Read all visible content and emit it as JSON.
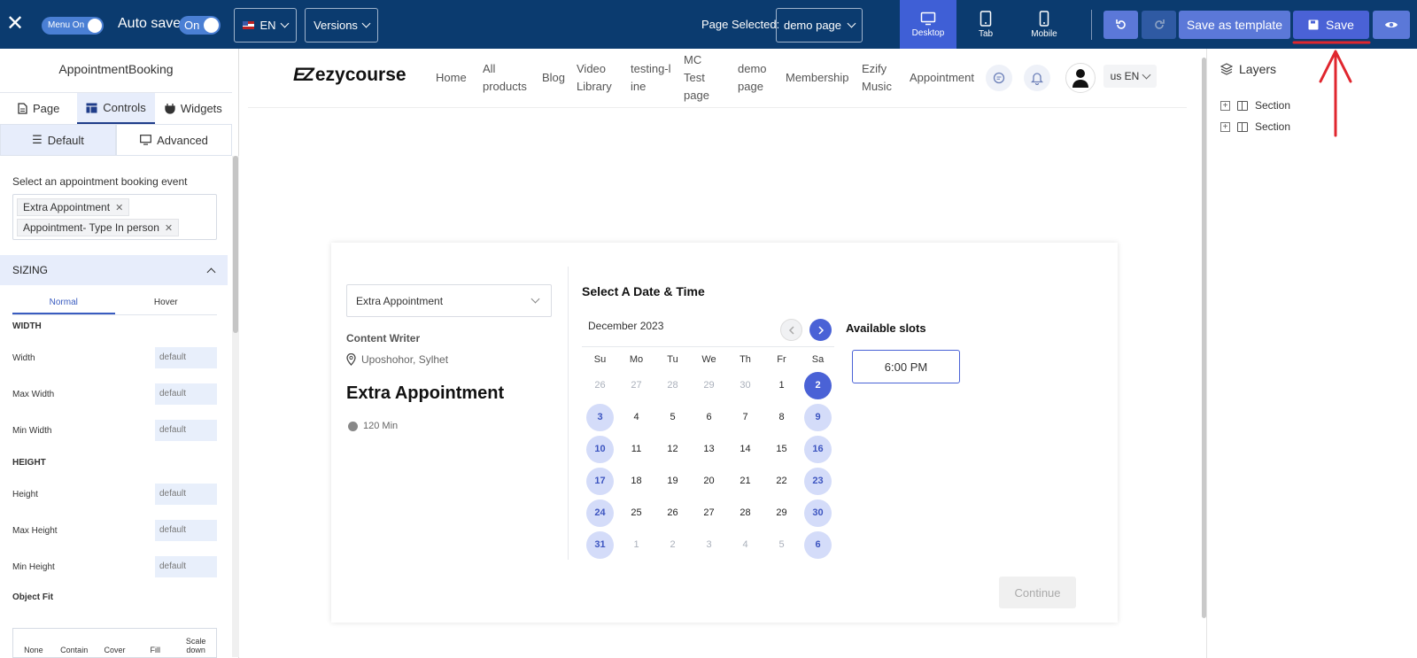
{
  "topbar": {
    "menu_toggle": "Menu On",
    "autosave_label": "Auto save:",
    "autosave_state": "On",
    "language": "EN",
    "versions": "Versions",
    "page_selected_label": "Page Selected:",
    "page_selected_value": "demo page",
    "devices": [
      {
        "label": "Desktop",
        "icon": "desktop-icon",
        "active": true
      },
      {
        "label": "Tab",
        "icon": "tablet-icon",
        "active": false
      },
      {
        "label": "Mobile",
        "icon": "mobile-icon",
        "active": false
      }
    ],
    "save_template": "Save as template",
    "save": "Save"
  },
  "left_panel": {
    "title": "AppointmentBooking",
    "tabs": [
      "Page",
      "Controls",
      "Widgets"
    ],
    "sub_tabs": [
      "Default",
      "Advanced"
    ],
    "event_select_label": "Select an appointment booking event",
    "selected_events": [
      "Extra Appointment",
      "Appointment- Type In person"
    ],
    "sizing_header": "SIZING",
    "state_tabs": [
      "Normal",
      "Hover"
    ],
    "width_section": "WIDTH",
    "height_section": "HEIGHT",
    "width_props": [
      {
        "label": "Width",
        "value": "default"
      },
      {
        "label": "Max Width",
        "value": "default"
      },
      {
        "label": "Min Width",
        "value": "default"
      }
    ],
    "height_props": [
      {
        "label": "Height",
        "value": "default"
      },
      {
        "label": "Max Height",
        "value": "default"
      },
      {
        "label": "Min Height",
        "value": "default"
      }
    ],
    "object_fit_label": "Object Fit",
    "object_fit_options": [
      "None",
      "Contain",
      "Cover",
      "Fill",
      "Scale down"
    ]
  },
  "site": {
    "logo_mark": "EZ",
    "logo_text": "ezycourse",
    "nav": [
      "Home",
      "All products",
      "Blog",
      "Video Library",
      "testing-line",
      "MC Test page",
      "demo page",
      "Membership",
      "Ezify Music",
      "Appointment"
    ],
    "locale": "us EN"
  },
  "booking": {
    "event_select": "Extra Appointment",
    "host": "Content Writer",
    "location": "Uposhohor, Sylhet",
    "title": "Extra Appointment",
    "duration": "120 Min",
    "calendar_heading": "Select A Date & Time",
    "month": "December 2023",
    "weekdays": [
      "Su",
      "Mo",
      "Tu",
      "We",
      "Th",
      "Fr",
      "Sa"
    ],
    "weeks": [
      [
        {
          "d": "26",
          "s": "muted"
        },
        {
          "d": "27",
          "s": "muted"
        },
        {
          "d": "28",
          "s": "muted"
        },
        {
          "d": "29",
          "s": "muted"
        },
        {
          "d": "30",
          "s": "muted"
        },
        {
          "d": "1",
          "s": ""
        },
        {
          "d": "2",
          "s": "selected"
        }
      ],
      [
        {
          "d": "3",
          "s": "avail"
        },
        {
          "d": "4",
          "s": ""
        },
        {
          "d": "5",
          "s": ""
        },
        {
          "d": "6",
          "s": ""
        },
        {
          "d": "7",
          "s": ""
        },
        {
          "d": "8",
          "s": ""
        },
        {
          "d": "9",
          "s": "avail"
        }
      ],
      [
        {
          "d": "10",
          "s": "avail"
        },
        {
          "d": "11",
          "s": ""
        },
        {
          "d": "12",
          "s": ""
        },
        {
          "d": "13",
          "s": ""
        },
        {
          "d": "14",
          "s": ""
        },
        {
          "d": "15",
          "s": ""
        },
        {
          "d": "16",
          "s": "avail"
        }
      ],
      [
        {
          "d": "17",
          "s": "avail"
        },
        {
          "d": "18",
          "s": ""
        },
        {
          "d": "19",
          "s": ""
        },
        {
          "d": "20",
          "s": ""
        },
        {
          "d": "21",
          "s": ""
        },
        {
          "d": "22",
          "s": ""
        },
        {
          "d": "23",
          "s": "avail"
        }
      ],
      [
        {
          "d": "24",
          "s": "avail"
        },
        {
          "d": "25",
          "s": ""
        },
        {
          "d": "26",
          "s": ""
        },
        {
          "d": "27",
          "s": ""
        },
        {
          "d": "28",
          "s": ""
        },
        {
          "d": "29",
          "s": ""
        },
        {
          "d": "30",
          "s": "avail"
        }
      ],
      [
        {
          "d": "31",
          "s": "avail"
        },
        {
          "d": "1",
          "s": "muted"
        },
        {
          "d": "2",
          "s": "muted"
        },
        {
          "d": "3",
          "s": "muted"
        },
        {
          "d": "4",
          "s": "muted"
        },
        {
          "d": "5",
          "s": "muted"
        },
        {
          "d": "6",
          "s": "avail"
        }
      ]
    ],
    "slots_heading": "Available slots",
    "slots": [
      "6:00 PM"
    ],
    "continue": "Continue"
  },
  "layers": {
    "title": "Layers",
    "items": [
      "Section",
      "Section"
    ]
  },
  "colors": {
    "topbar": "#0b3b6f",
    "accent": "#4a62d6",
    "annotation": "#e0262e"
  }
}
